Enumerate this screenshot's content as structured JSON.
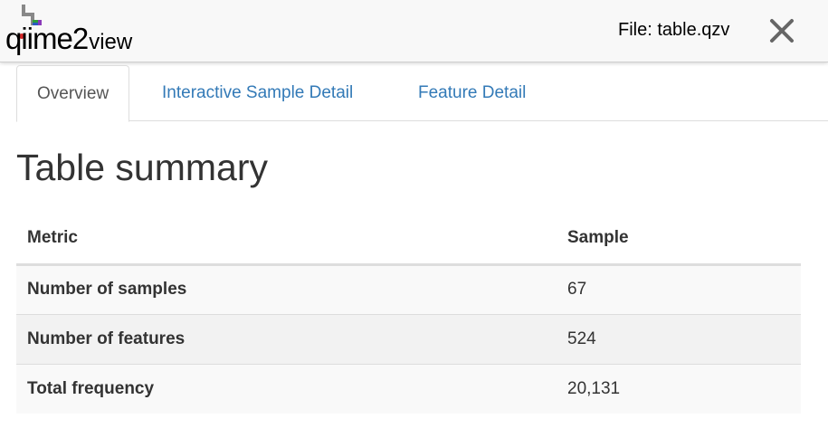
{
  "header": {
    "logo_main": "qiime2",
    "logo_view": "view",
    "file_label": "File: table.qzv",
    "close_icon": "close-icon"
  },
  "tabs": [
    {
      "label": "Overview",
      "active": true
    },
    {
      "label": "Interactive Sample Detail",
      "active": false
    },
    {
      "label": "Feature Detail",
      "active": false
    }
  ],
  "page_title": "Table summary",
  "table": {
    "headers": [
      "Metric",
      "Sample"
    ],
    "rows": [
      {
        "metric": "Number of samples",
        "value": "67"
      },
      {
        "metric": "Number of features",
        "value": "524"
      },
      {
        "metric": "Total frequency",
        "value": "20,131"
      }
    ]
  },
  "colors": {
    "link": "#337ab7",
    "active_tab_text": "#555555",
    "header_bg": "#f8f8f8"
  }
}
